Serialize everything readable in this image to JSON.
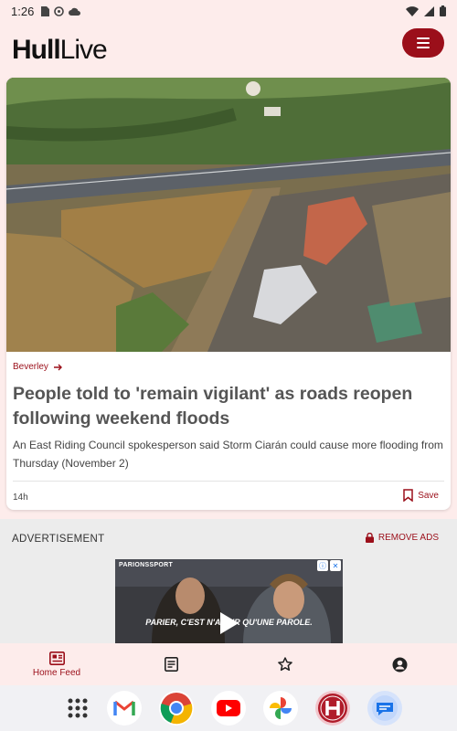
{
  "status_bar": {
    "time": "1:26"
  },
  "header": {
    "logo_bold": "Hull",
    "logo_regular": "Live"
  },
  "article": {
    "tag": "Beverley",
    "headline": "People told to 'remain vigilant' as roads reopen following weekend floods",
    "summary": "An East Riding Council spokesperson said Storm Ciarán could cause more flooding from Thursday (November 2)",
    "time_ago": "14h",
    "save_label": "Save"
  },
  "ad": {
    "label": "ADVERTISEMENT",
    "remove_label": "REMOVE ADS",
    "brand": "PARIONSSPORT",
    "caption": "PARIER, C'EST N'AVOIR QU'UNE PAROLE."
  },
  "bottom_nav": {
    "home_label": "Home Feed"
  },
  "colors": {
    "brand": "#9b0f1a",
    "background": "#fdeceb"
  }
}
